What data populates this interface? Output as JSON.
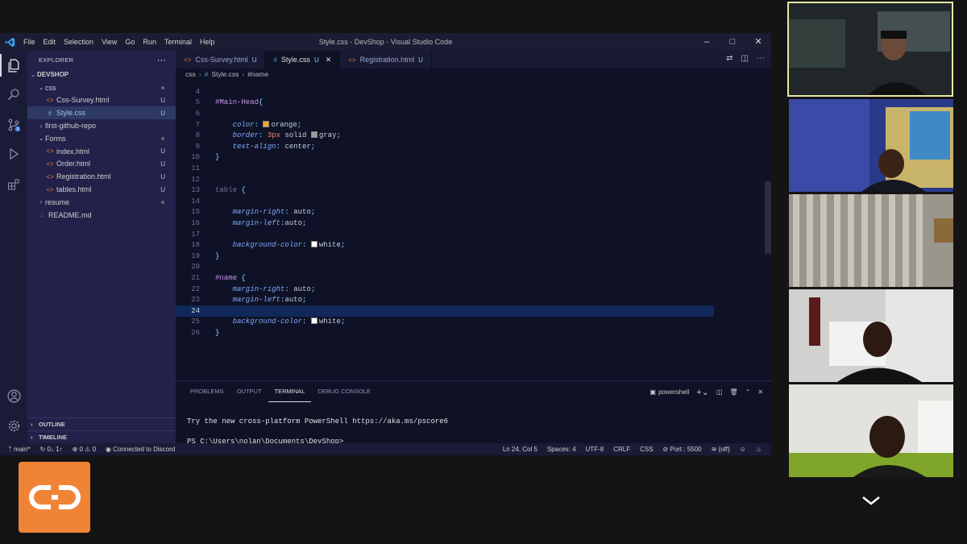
{
  "window": {
    "title": "Style.css - DevShop - Visual Studio Code",
    "menu": [
      "File",
      "Edit",
      "Selection",
      "View",
      "Go",
      "Run",
      "Terminal",
      "Help"
    ]
  },
  "sidebar": {
    "header": "EXPLORER",
    "root": "DEVSHOP",
    "items": [
      {
        "label": "css",
        "kind": "folder-open",
        "status": "dot"
      },
      {
        "label": "Css-Survey.html",
        "kind": "html",
        "status": "U"
      },
      {
        "label": "Style.css",
        "kind": "css",
        "status": "U",
        "selected": true
      },
      {
        "label": "first-github-repo",
        "kind": "folder-closed",
        "status": ""
      },
      {
        "label": "Forms",
        "kind": "folder-open",
        "status": "dot"
      },
      {
        "label": "index.html",
        "kind": "html",
        "status": "U"
      },
      {
        "label": "Order.html",
        "kind": "html",
        "status": "U"
      },
      {
        "label": "Registration.html",
        "kind": "html",
        "status": "U"
      },
      {
        "label": "tables.html",
        "kind": "html",
        "status": "U"
      },
      {
        "label": "resume",
        "kind": "folder-closed",
        "status": "dot"
      },
      {
        "label": "README.md",
        "kind": "md",
        "status": ""
      }
    ],
    "outline": "OUTLINE",
    "timeline": "TIMELINE"
  },
  "tabs": [
    {
      "label": "Css-Survey.html",
      "kind": "html",
      "status": "U"
    },
    {
      "label": "Style.css",
      "kind": "css",
      "status": "U",
      "active": true
    },
    {
      "label": "Registration.html",
      "kind": "html",
      "status": "U"
    }
  ],
  "breadcrumb": [
    "css",
    "#",
    "Style.css",
    "#name"
  ],
  "code": [
    {
      "n": "4",
      "t": ""
    },
    {
      "n": "5",
      "t": "#Main-Head{"
    },
    {
      "n": "6",
      "t": ""
    },
    {
      "n": "7",
      "t": "    color: orange;"
    },
    {
      "n": "8",
      "t": "    border: 3px solid gray;"
    },
    {
      "n": "9",
      "t": "    text-align: center;"
    },
    {
      "n": "10",
      "t": "}"
    },
    {
      "n": "11",
      "t": ""
    },
    {
      "n": "12",
      "t": ""
    },
    {
      "n": "13",
      "t": "table {"
    },
    {
      "n": "14",
      "t": ""
    },
    {
      "n": "15",
      "t": "    margin-right: auto;"
    },
    {
      "n": "16",
      "t": "    margin-left:auto;"
    },
    {
      "n": "17",
      "t": ""
    },
    {
      "n": "18",
      "t": "    background-color: white;"
    },
    {
      "n": "19",
      "t": "}"
    },
    {
      "n": "20",
      "t": ""
    },
    {
      "n": "21",
      "t": "#name {"
    },
    {
      "n": "22",
      "t": "    margin-right: auto;"
    },
    {
      "n": "23",
      "t": "    margin-left:auto;"
    },
    {
      "n": "24",
      "t": ""
    },
    {
      "n": "25",
      "t": "    background-color: white;"
    },
    {
      "n": "26",
      "t": "}"
    }
  ],
  "current_line": "24",
  "panel": {
    "tabs": [
      "PROBLEMS",
      "OUTPUT",
      "TERMINAL",
      "DEBUG CONSOLE"
    ],
    "active_tab": "TERMINAL",
    "shell": "powershell",
    "terminal_lines": [
      "Try the new cross-platform PowerShell https://aka.ms/pscore6",
      "PS C:\\Users\\nolan\\Documents\\DevShop>"
    ]
  },
  "statusbar": {
    "branch": "main*",
    "sync": "0↓ 1↑",
    "errors": "0",
    "warnings": "0",
    "discord": "Connected to Discord",
    "position": "Ln 24, Col 5",
    "spaces": "Spaces: 4",
    "encoding": "UTF-8",
    "eol": "CRLF",
    "language": "CSS",
    "port": "Port : 5500",
    "off": "{off}"
  },
  "colors": {
    "accent_orange": "#f08436",
    "swatch_orange": "#f5a623",
    "swatch_gray": "#9b9b9b",
    "swatch_white": "#ffffff"
  }
}
